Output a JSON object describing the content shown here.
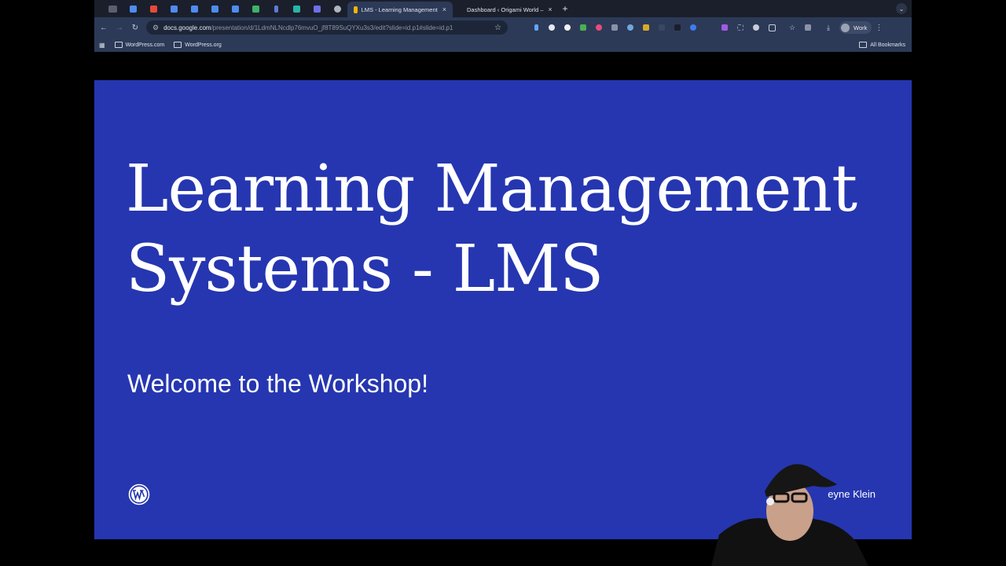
{
  "tabs": {
    "active_label": "LMS - Learning Management",
    "second_label": "Dashboard ‹ Origami World –",
    "new_tab": "+",
    "close": "×"
  },
  "toolbar": {
    "url_host": "docs.google.com",
    "url_path": "/presentation/d/1LdmNLNcdlp76mvuO_jf8T89SuQYXu3s3/edit?slide=id.p1#slide=id.p1",
    "profile_label": "Work"
  },
  "bookmarks": {
    "items": [
      "WordPress.com",
      "WordPress.org"
    ],
    "all_label": "All Bookmarks"
  },
  "slide": {
    "title_line1": "Learning Management",
    "title_line2": "Systems - LMS",
    "subtitle": "Welcome to the Workshop!",
    "presenter": "eyne Klein",
    "logo_icon": "wordpress-logo-icon"
  },
  "colors": {
    "slide_bg": "#2536b0",
    "toolbar_bg": "#2c3a58",
    "tabstrip_bg": "#1a1f2b"
  }
}
